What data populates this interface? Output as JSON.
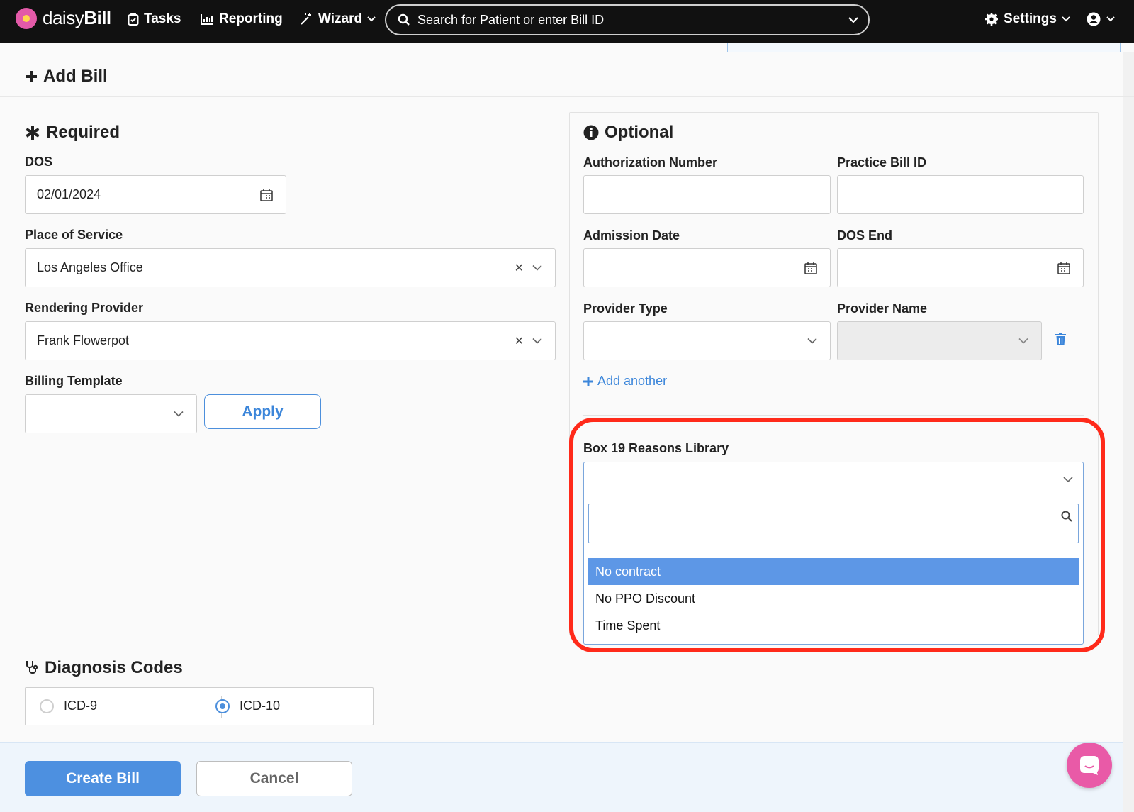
{
  "nav": {
    "brand_prefix": "daisy",
    "brand_suffix": "Bill",
    "tasks": "Tasks",
    "reporting": "Reporting",
    "wizard": "Wizard",
    "search_placeholder": "Search for Patient or enter Bill ID",
    "settings": "Settings"
  },
  "page": {
    "title": "Add Bill"
  },
  "required": {
    "heading": "Required",
    "dos_label": "DOS",
    "dos_value": "02/01/2024",
    "place_label": "Place of Service",
    "place_value": "Los Angeles Office",
    "provider_label": "Rendering Provider",
    "provider_value": "Frank Flowerpot",
    "template_label": "Billing Template",
    "template_value": "",
    "apply_label": "Apply"
  },
  "optional": {
    "heading": "Optional",
    "auth_label": "Authorization Number",
    "auth_value": "",
    "practice_label": "Practice Bill ID",
    "practice_value": "",
    "admission_label": "Admission Date",
    "admission_value": "",
    "dos_end_label": "DOS End",
    "dos_end_value": "",
    "provider_type_label": "Provider Type",
    "provider_type_value": "",
    "provider_name_label": "Provider Name",
    "provider_name_value": "",
    "add_another": "Add another"
  },
  "box19": {
    "label": "Box 19 Reasons Library",
    "selected": "",
    "search_value": "",
    "options": [
      "No contract",
      "No PPO Discount",
      "Time Spent"
    ],
    "active_index": 0
  },
  "diagnosis": {
    "heading": "Diagnosis Codes",
    "options": [
      "ICD-9",
      "ICD-10"
    ],
    "selected": "ICD-10"
  },
  "footer": {
    "create_label": "Create Bill",
    "cancel_label": "Cancel"
  },
  "colors": {
    "accent": "#4d90e0",
    "highlight": "#ff2a1a",
    "brand": "#e95aa7"
  }
}
